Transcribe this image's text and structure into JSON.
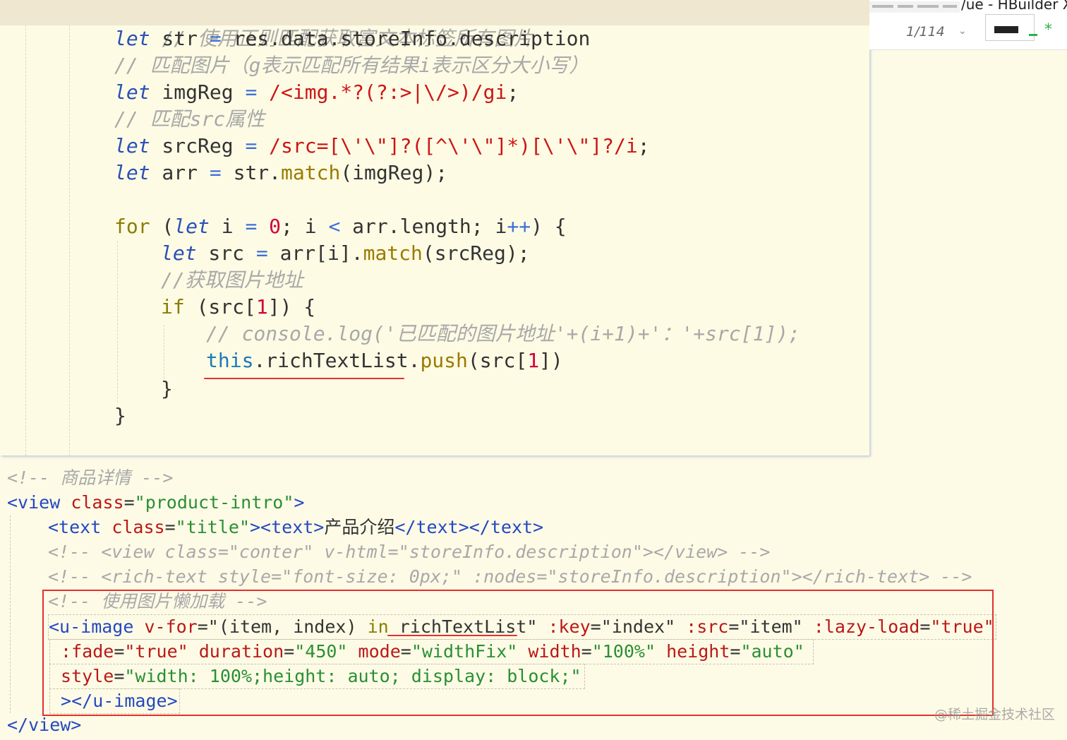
{
  "window": {
    "title": "/ue - HBuilder X",
    "page_indicator": "1/114"
  },
  "icons": {
    "chevron": "chevron-down-icon",
    "modified": "asterisk-icon",
    "accent_green": "#2bb24c",
    "annotation_red": "#e2302e"
  },
  "top_code": {
    "l0_comment": "// 使用正则匹配获取富文本标签所有图片",
    "l1_kw": "let",
    "l1_var": " str ",
    "l1_op": "=",
    "l1_rest": " res.data.storeInfo.description",
    "l2_comment": "// 匹配图片（g表示匹配所有结果i表示区分大小写）",
    "l3_kw": "let",
    "l3_var": " imgReg ",
    "l3_op": "=",
    "l3_regex": " /<img.*?(?:>|\\/>)/gi",
    "l3_end": ";",
    "l4_comment": "// 匹配src属性",
    "l5_kw": "let",
    "l5_var": " srcReg ",
    "l5_op": "=",
    "l5_regex": " /src=[\\'\\\"]?([^\\'\\\"]*)[\\'\\\"]?/i",
    "l5_end": ";",
    "l6_kw": "let",
    "l6_var": " arr ",
    "l6_op": "=",
    "l6_a": " str.",
    "l6_fn": "match",
    "l6_b": "(imgReg);",
    "l8_for": "for",
    "l8_a": " (",
    "l8_kw": "let",
    "l8_b": " i ",
    "l8_op1": "=",
    "l8_sp": " ",
    "l8_num": "0",
    "l8_c": "; i ",
    "l8_op2": "<",
    "l8_d": " arr.length; i",
    "l8_op3": "++",
    "l8_e": ") {",
    "l9_kw": "let",
    "l9_a": " src ",
    "l9_op": "=",
    "l9_b": " arr[i].",
    "l9_fn": "match",
    "l9_c": "(srcReg);",
    "l10_comment": "//获取图片地址",
    "l11_if": "if",
    "l11_a": " (src[",
    "l11_num": "1",
    "l11_b": "]) {",
    "l12_comment": "// console.log('已匹配的图片地址'+(i+1)+'：'+src[1]);",
    "l13_this": "this",
    "l13_a": ".richTextList.",
    "l13_fn": "push",
    "l13_b": "(src[",
    "l13_num": "1",
    "l13_c": "])",
    "l14_close": "}",
    "l15_close": "}"
  },
  "bottom_code": {
    "b0_comment": "<!-- 商品详情 -->",
    "b1_tag": "<view",
    "b1_attr": " class",
    "b1_eq": "=",
    "b1_val": "\"product-intro\"",
    "b1_close": ">",
    "b2_tag": "<text",
    "b2_attr": " class",
    "b2_eq": "=",
    "b2_val": "\"title\"",
    "b2_tag2": "><text>",
    "b2_text": "产品介绍",
    "b2_tag3": "</text></text>",
    "b3_comment": "<!-- <view class=\"conter\" v-html=\"storeInfo.description\"></view> -->",
    "b4_comment": "<!-- <rich-text style=\"font-size: 0px;\" :nodes=\"storeInfo.description\"></rich-text> -->",
    "b5_comment": "<!-- 使用图片懒加载 -->",
    "b6_tag": "<u-image",
    "b6_attr1": " v-for",
    "b6_eq1": "=",
    "b6_val1a": "\"(item, index) ",
    "b6_in": "in",
    "b6_val1b": " richTextList\"",
    "b6_attr2": " :key",
    "b6_eq2": "=",
    "b6_val2": "\"index\"",
    "b6_attr3": " :src",
    "b6_eq3": "=",
    "b6_val3": "\"item\"",
    "b6_attr4": " :lazy-load",
    "b6_eq4": "=",
    "b6_val4": "\"true\"",
    "b7_attr1": " :fade",
    "b7_eq1": "=",
    "b7_val1": "\"true\"",
    "b7_attr2": " duration",
    "b7_eq2": "=",
    "b7_val2": "\"450\"",
    "b7_attr3": " mode",
    "b7_eq3": "=",
    "b7_val3": "\"widthFix\"",
    "b7_attr4": " width",
    "b7_eq4": "=",
    "b7_val4": "\"100%\"",
    "b7_attr5": " height",
    "b7_eq5": "=",
    "b7_val5": "\"auto\"",
    "b8_attr": " style",
    "b8_eq": "=",
    "b8_val": "\"width: 100%;height: auto; display: block;\"",
    "b9_tag": " ></u-image>",
    "b10_tag": "</view>"
  },
  "watermark": "@稀土掘金技术社区"
}
